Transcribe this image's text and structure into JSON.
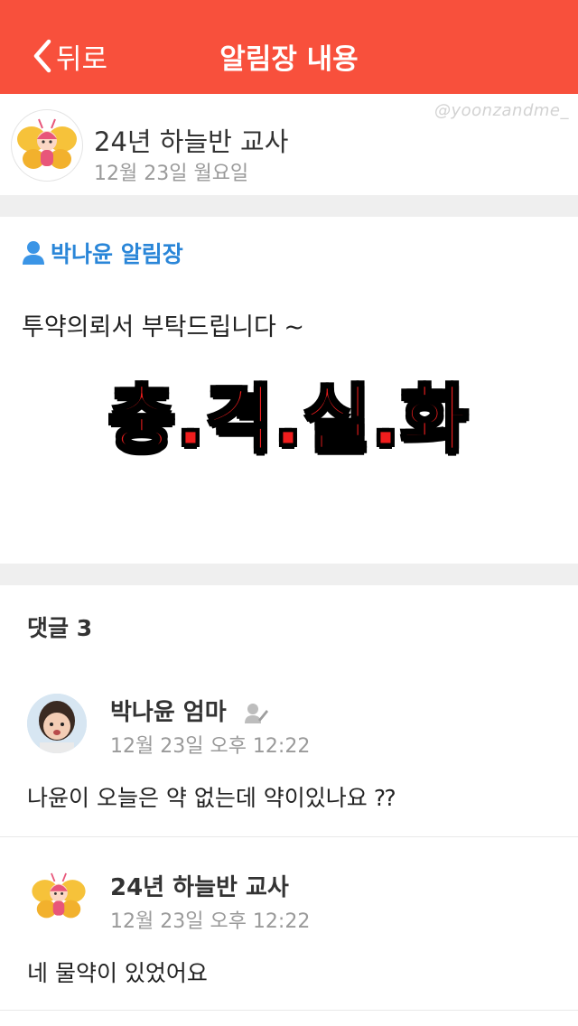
{
  "nav": {
    "back_label": "뒤로",
    "title": "알림장 내용"
  },
  "post": {
    "author": "24년 하늘반 교사",
    "date": "12월 23일 월요일",
    "watermark": "@yoonzandme_",
    "notice_label": "박나윤 알림장",
    "body": "투약의뢰서 부탁드립니다 ~",
    "overlay_caption": "충.격.실.화"
  },
  "comments": {
    "title": "댓글 3",
    "items": [
      {
        "name": "박나윤 엄마",
        "time": "12월 23일 오후 12:22",
        "text": "나윤이 오늘은 약 없는데 약이있나요 ⁇"
      },
      {
        "name": "24년 하늘반 교사",
        "time": "12월 23일 오후 12:22",
        "text": "네 물약이 있었어요"
      }
    ]
  },
  "colors": {
    "navbar": "#f8503c",
    "notice_label": "#2a86d8",
    "overlay": "#ef1d1d"
  }
}
